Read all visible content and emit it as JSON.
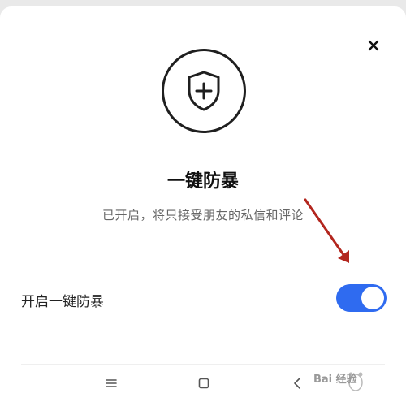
{
  "dialog": {
    "title": "一键防暴",
    "subtitle": "已开启，将只接受朋友的私信和评论",
    "close_icon": "close-icon",
    "shield_icon": "shield-plus-icon"
  },
  "setting": {
    "label": "开启一键防暴",
    "enabled": true,
    "toggle_color": "#2f6bf0"
  },
  "nav": {
    "menu_icon": "menu-icon",
    "home_icon": "home-square-icon",
    "back_icon": "back-chevron-icon"
  },
  "watermark": {
    "text": "Bai 经验",
    "annotation": "red-arrow-annotation",
    "annotation_color": "#b3261e"
  }
}
